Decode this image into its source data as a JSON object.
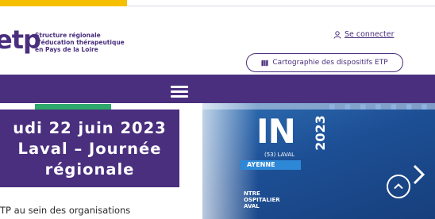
{
  "colors": {
    "brand": "#4a2f7e",
    "accent_yellow": "#f6c000",
    "tag_green": "#2ea86b"
  },
  "logo": {
    "mark": "etp",
    "lines": [
      "Structure régionale",
      "d'éducation thérapeutique",
      "en Pays de la Loire"
    ]
  },
  "header": {
    "login_label": "Se connecter",
    "login_icon": "user-icon",
    "carto_label": "Cartographie des dispositifs ETP",
    "carto_icon": "map-icon"
  },
  "nav": {
    "menu_icon": "hamburger-icon"
  },
  "hero": {
    "title_lines": [
      "udi 22 juin 2023",
      "Laval – Journée",
      "régionale"
    ],
    "image_text": {
      "big": "IN",
      "year": "2023",
      "city": "(53) LAVAL",
      "dept": "AYENNE",
      "hospital_lines": [
        "NTRE",
        "OSPITALIER",
        "AVAL"
      ]
    },
    "next_icon": "chevron-right-icon",
    "scroll_up_icon": "chevron-up-icon"
  },
  "subtitle": "TP au sein des organisations"
}
